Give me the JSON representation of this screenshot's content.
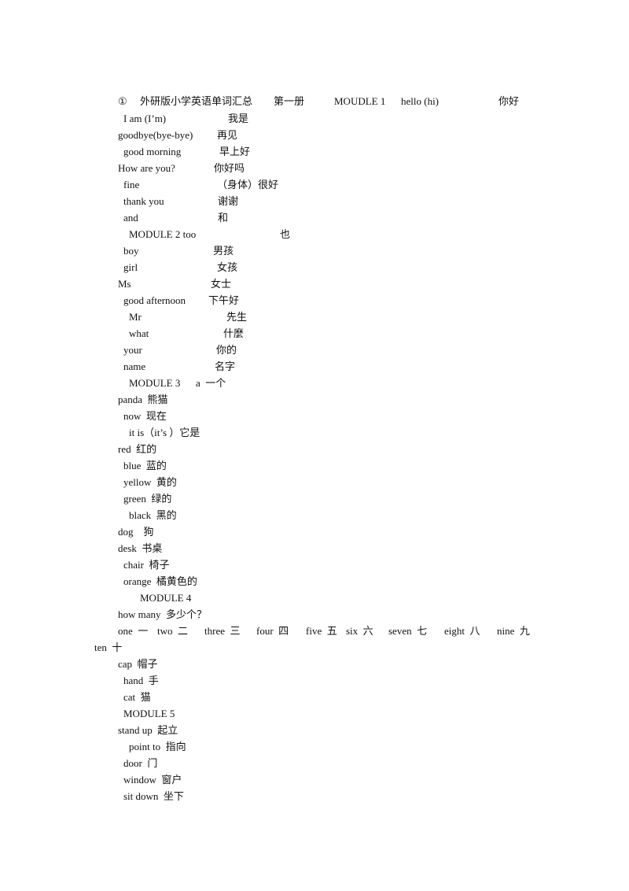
{
  "document": {
    "lines": [
      {
        "segments": [
          "①",
          "外研版小学英语单词汇总",
          "第一册",
          "MOUDLE 1",
          "hello (hi)",
          "你好"
        ]
      },
      {
        "segments": [
          "I am (I’m)",
          "我是"
        ]
      },
      {
        "segments": [
          "goodbye(bye-bye)",
          "再见"
        ]
      },
      {
        "segments": [
          "good morning",
          "早上好"
        ]
      },
      {
        "segments": [
          "How are you?",
          "你好吗"
        ]
      },
      {
        "segments": [
          "fine",
          "（身体）很好"
        ]
      },
      {
        "segments": [
          "thank you",
          "谢谢"
        ]
      },
      {
        "segments": [
          "and",
          "和"
        ]
      },
      {
        "segments": [
          "MODULE 2 too",
          "也"
        ]
      },
      {
        "segments": [
          "boy",
          "男孩"
        ]
      },
      {
        "segments": [
          "girl",
          "女孩"
        ]
      },
      {
        "segments": [
          "Ms",
          "女士"
        ]
      },
      {
        "segments": [
          "good afternoon",
          "下午好"
        ]
      },
      {
        "segments": [
          "Mr",
          "先生"
        ]
      },
      {
        "segments": [
          "what",
          "什麼"
        ]
      },
      {
        "segments": [
          "your",
          "你的"
        ]
      },
      {
        "segments": [
          "name",
          "名字"
        ]
      },
      {
        "segments": [
          "MODULE 3",
          "a  一个"
        ]
      },
      {
        "segments": [
          "panda  熊猫"
        ]
      },
      {
        "segments": [
          "now  现在"
        ]
      },
      {
        "segments": [
          "it is（it’s ）它是"
        ]
      },
      {
        "segments": [
          "red  红的"
        ]
      },
      {
        "segments": [
          "blue  蓝的"
        ]
      },
      {
        "segments": [
          "yellow  黄的"
        ]
      },
      {
        "segments": [
          "green  绿的"
        ]
      },
      {
        "segments": [
          "black  黑的"
        ]
      },
      {
        "segments": [
          "dog    狗"
        ]
      },
      {
        "segments": [
          "desk  书桌"
        ]
      },
      {
        "segments": [
          "chair  椅子"
        ]
      },
      {
        "segments": [
          "orange  橘黄色的"
        ]
      },
      {
        "segments": [
          "MODULE 4"
        ]
      },
      {
        "segments": [
          "how many  多少个？"
        ]
      },
      {
        "segments": [
          "one  一",
          "two  二",
          "three  三",
          "four  四",
          "five  五",
          "six  六",
          "seven  七",
          "eight  八",
          "nine  九"
        ]
      },
      {
        "segments": [
          "ten  十"
        ]
      },
      {
        "segments": [
          "cap  帽子"
        ]
      },
      {
        "segments": [
          "hand  手"
        ]
      },
      {
        "segments": [
          "cat  猫"
        ]
      },
      {
        "segments": [
          "MODULE 5"
        ]
      },
      {
        "segments": [
          "stand up  起立"
        ]
      },
      {
        "segments": [
          "point to  指向"
        ]
      },
      {
        "segments": [
          "door  门"
        ]
      },
      {
        "segments": [
          "window  窗户"
        ]
      },
      {
        "segments": [
          "sit down  坐下"
        ]
      }
    ]
  }
}
